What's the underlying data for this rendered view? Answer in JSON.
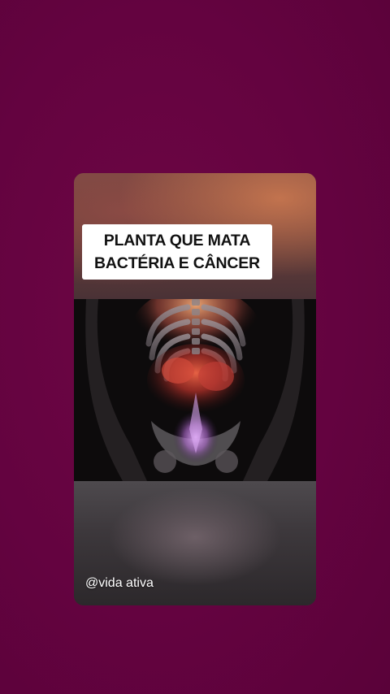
{
  "story": {
    "caption_lines": [
      "PLANTA QUE MATA",
      "BACTÉRIA E CÂNCER"
    ],
    "handle": "@vida ativa",
    "media_description_icon": "xray-body-scan-image"
  },
  "colors": {
    "page_background": "#640340",
    "caption_background": "#ffffff",
    "caption_text": "#111111",
    "handle_text": "#ffffff"
  }
}
